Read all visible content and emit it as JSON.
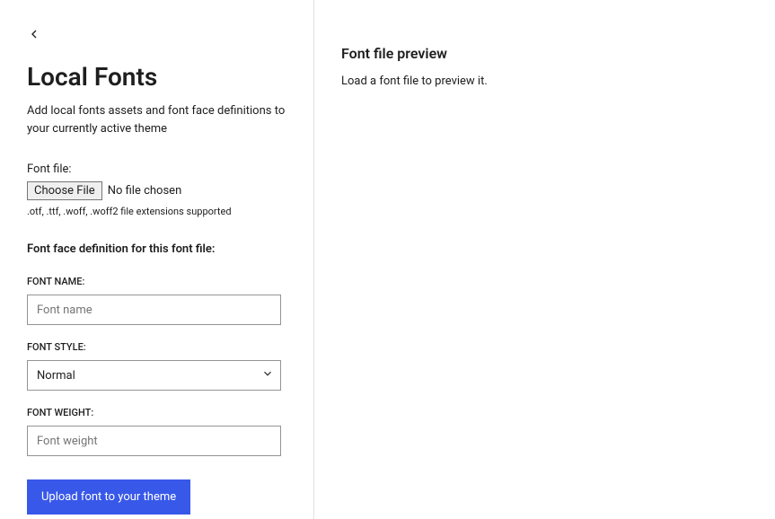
{
  "left": {
    "title": "Local Fonts",
    "description": "Add local fonts assets and font face definitions to your currently active theme",
    "fontFileLabel": "Font file:",
    "chooseFileLabel": "Choose File",
    "noFileLabel": "No file chosen",
    "fileHint": ".otf, .ttf, .woff, .woff2 file extensions supported",
    "sectionTitle": "Font face definition for this font file:",
    "fields": {
      "fontName": {
        "label": "FONT NAME:",
        "placeholder": "Font name",
        "value": ""
      },
      "fontStyle": {
        "label": "FONT STYLE:",
        "value": "Normal"
      },
      "fontWeight": {
        "label": "FONT WEIGHT:",
        "placeholder": "Font weight",
        "value": ""
      }
    },
    "uploadButton": "Upload font to your theme"
  },
  "right": {
    "title": "Font file preview",
    "message": "Load a font file to preview it."
  }
}
